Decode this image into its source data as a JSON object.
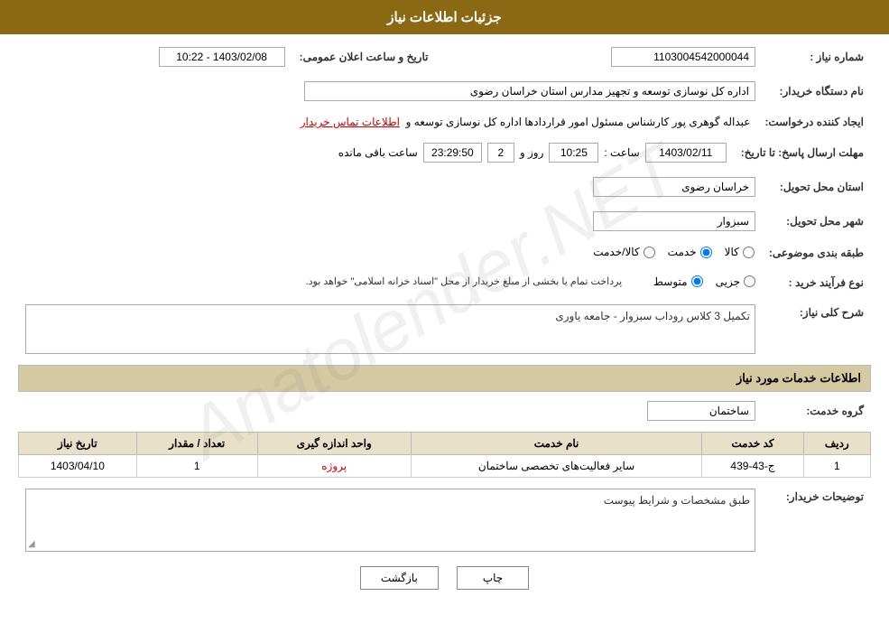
{
  "header": {
    "title": "جزئیات اطلاعات نیاز"
  },
  "fields": {
    "need_number_label": "شماره نیاز :",
    "need_number_value": "1103004542000044",
    "buyer_org_label": "نام دستگاه خریدار:",
    "buyer_org_value": "اداره کل نوسازی  توسعه و تجهیز مدارس استان خراسان رضوی",
    "creator_label": "ایجاد کننده درخواست:",
    "creator_value": "عبداله گوهری پور کارشناس مسئول امور قراردادها  اداره کل نوسازی  توسعه و",
    "creator_contact_link": "اطلاعات تماس خریدار",
    "reply_deadline_label": "مهلت ارسال پاسخ: تا تاریخ:",
    "reply_date": "1403/02/11",
    "reply_time_label": "ساعت :",
    "reply_time": "10:25",
    "reply_days_label": "روز و",
    "reply_days": "2",
    "reply_remaining_label": "ساعت باقی مانده",
    "reply_remaining": "23:29:50",
    "province_label": "استان محل تحویل:",
    "province_value": "خراسان رضوی",
    "city_label": "شهر محل تحویل:",
    "city_value": "سبزوار",
    "category_label": "طبقه بندی موضوعی:",
    "category_goods": "کالا",
    "category_service": "خدمت",
    "category_both": "کالا/خدمت",
    "category_selected": "خدمت",
    "purchase_type_label": "نوع فرآیند خرید :",
    "purchase_partial": "جزیی",
    "purchase_medium": "متوسط",
    "purchase_notice": "پرداخت تمام یا بخشی از مبلغ خریدار از محل \"اسناد خزانه اسلامی\" خواهد بود.",
    "announcement_date_label": "تاریخ و ساعت اعلان عمومی:",
    "announcement_date_value": "1403/02/08 - 10:22",
    "need_summary_label": "شرح کلی نیاز:",
    "need_summary_value": "تکمیل 3 کلاس روداب سبزوار - جامعه یاوری",
    "services_section_label": "اطلاعات خدمات مورد نیاز",
    "service_group_label": "گروه خدمت:",
    "service_group_value": "ساختمان",
    "table_headers": {
      "row": "ردیف",
      "code": "کد خدمت",
      "name": "نام خدمت",
      "unit": "واحد اندازه گیری",
      "quantity": "تعداد / مقدار",
      "date": "تاریخ نیاز"
    },
    "table_rows": [
      {
        "row": "1",
        "code": "ج-43-439",
        "name": "سایر فعالیت‌های تخصصی ساختمان",
        "unit": "پروژه",
        "quantity": "1",
        "date": "1403/04/10"
      }
    ],
    "buyer_desc_label": "توضیحات خریدار:",
    "buyer_desc_value": "طبق مشخصات و شرایط پیوست"
  },
  "buttons": {
    "print": "چاپ",
    "back": "بازگشت"
  }
}
